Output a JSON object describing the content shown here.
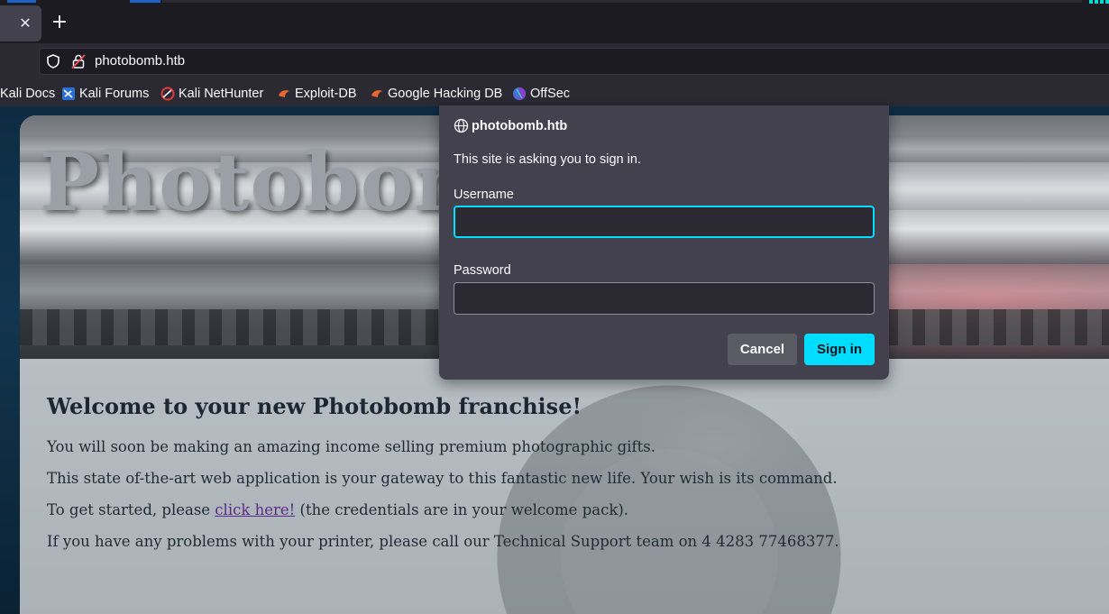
{
  "browser": {
    "tab_close_glyph": "✕",
    "new_tab_glyph": "+",
    "url": "photobomb.htb",
    "bookmarks": [
      {
        "label": "Kali Docs",
        "icon": "kali-docs-icon"
      },
      {
        "label": "Kali Forums",
        "icon": "kali-forums-icon"
      },
      {
        "label": "Kali NetHunter",
        "icon": "kali-nethunter-icon"
      },
      {
        "label": "Exploit-DB",
        "icon": "exploit-db-icon"
      },
      {
        "label": "Google Hacking DB",
        "icon": "ghdb-icon"
      },
      {
        "label": "OffSec",
        "icon": "offsec-icon"
      }
    ],
    "accent_color": "#00ddff"
  },
  "page": {
    "hero_title": "Photobomb",
    "welcome_heading": "Welcome to your new Photobomb franchise!",
    "para1": "You will soon be making an amazing income selling premium photographic gifts.",
    "para2": "This state of-the-art web application is your gateway to this fantastic new life. Your wish is its command.",
    "para3_before": "To get started, please ",
    "para3_link": "click here!",
    "para3_after": " (the credentials are in your welcome pack).",
    "para4": "If you have any problems with your printer, please call our Technical Support team on 4 4283 77468377."
  },
  "auth_dialog": {
    "host": "photobomb.htb",
    "message": "This site is asking you to sign in.",
    "username_label": "Username",
    "username_value": "",
    "password_label": "Password",
    "password_value": "",
    "cancel_label": "Cancel",
    "signin_label": "Sign in"
  }
}
